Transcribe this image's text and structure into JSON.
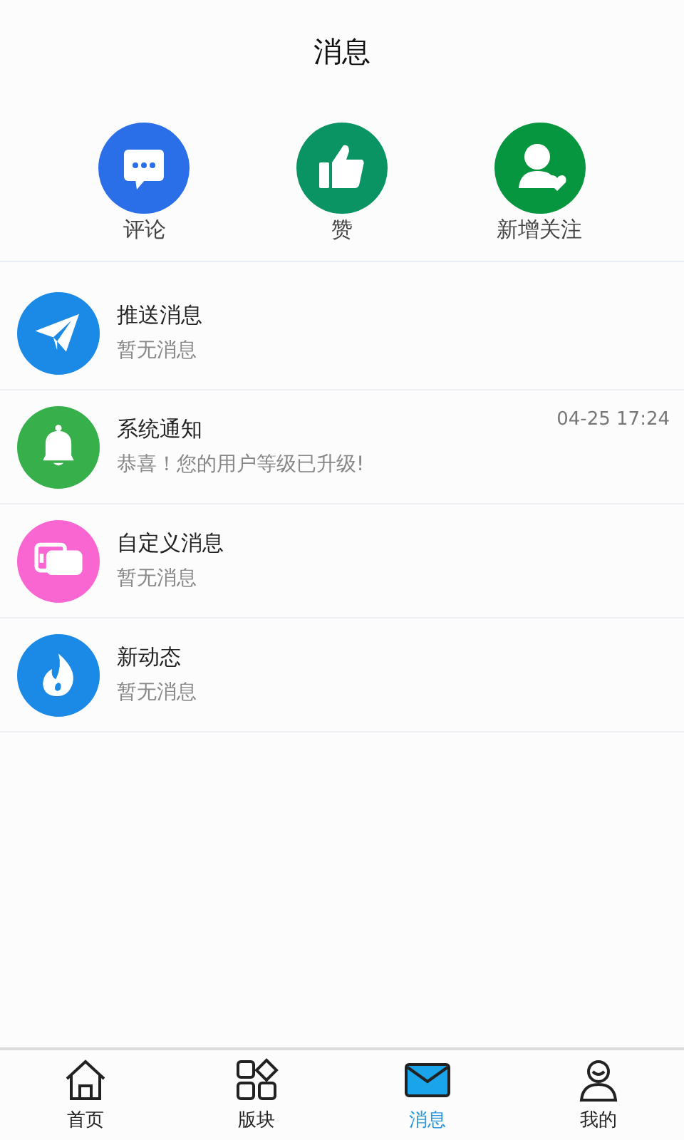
{
  "header": {
    "title": "消息"
  },
  "shortcuts": [
    {
      "label": "评论",
      "kind": "comment",
      "color": "#2a6fe8"
    },
    {
      "label": "赞",
      "kind": "like",
      "color": "#0a9463"
    },
    {
      "label": "新增关注",
      "kind": "follow",
      "color": "#06963f"
    }
  ],
  "messages": [
    {
      "title": "推送消息",
      "preview": "暂无消息",
      "kind": "send",
      "color": "#1a8ae6"
    },
    {
      "title": "系统通知",
      "preview": "恭喜！您的用户等级已升级!",
      "time": "04-25 17:24",
      "kind": "bell",
      "color": "#37b04c"
    },
    {
      "title": "自定义消息",
      "preview": "暂无消息",
      "kind": "chat",
      "color": "#f966d2"
    },
    {
      "title": "新动态",
      "preview": "暂无消息",
      "kind": "flame",
      "color": "#1a8ae6"
    }
  ],
  "tabs": [
    {
      "label": "首页",
      "kind": "home",
      "selected": false
    },
    {
      "label": "版块",
      "kind": "blocks",
      "selected": false
    },
    {
      "label": "消息",
      "kind": "mail",
      "selected": true
    },
    {
      "label": "我的",
      "kind": "user",
      "selected": false
    }
  ]
}
